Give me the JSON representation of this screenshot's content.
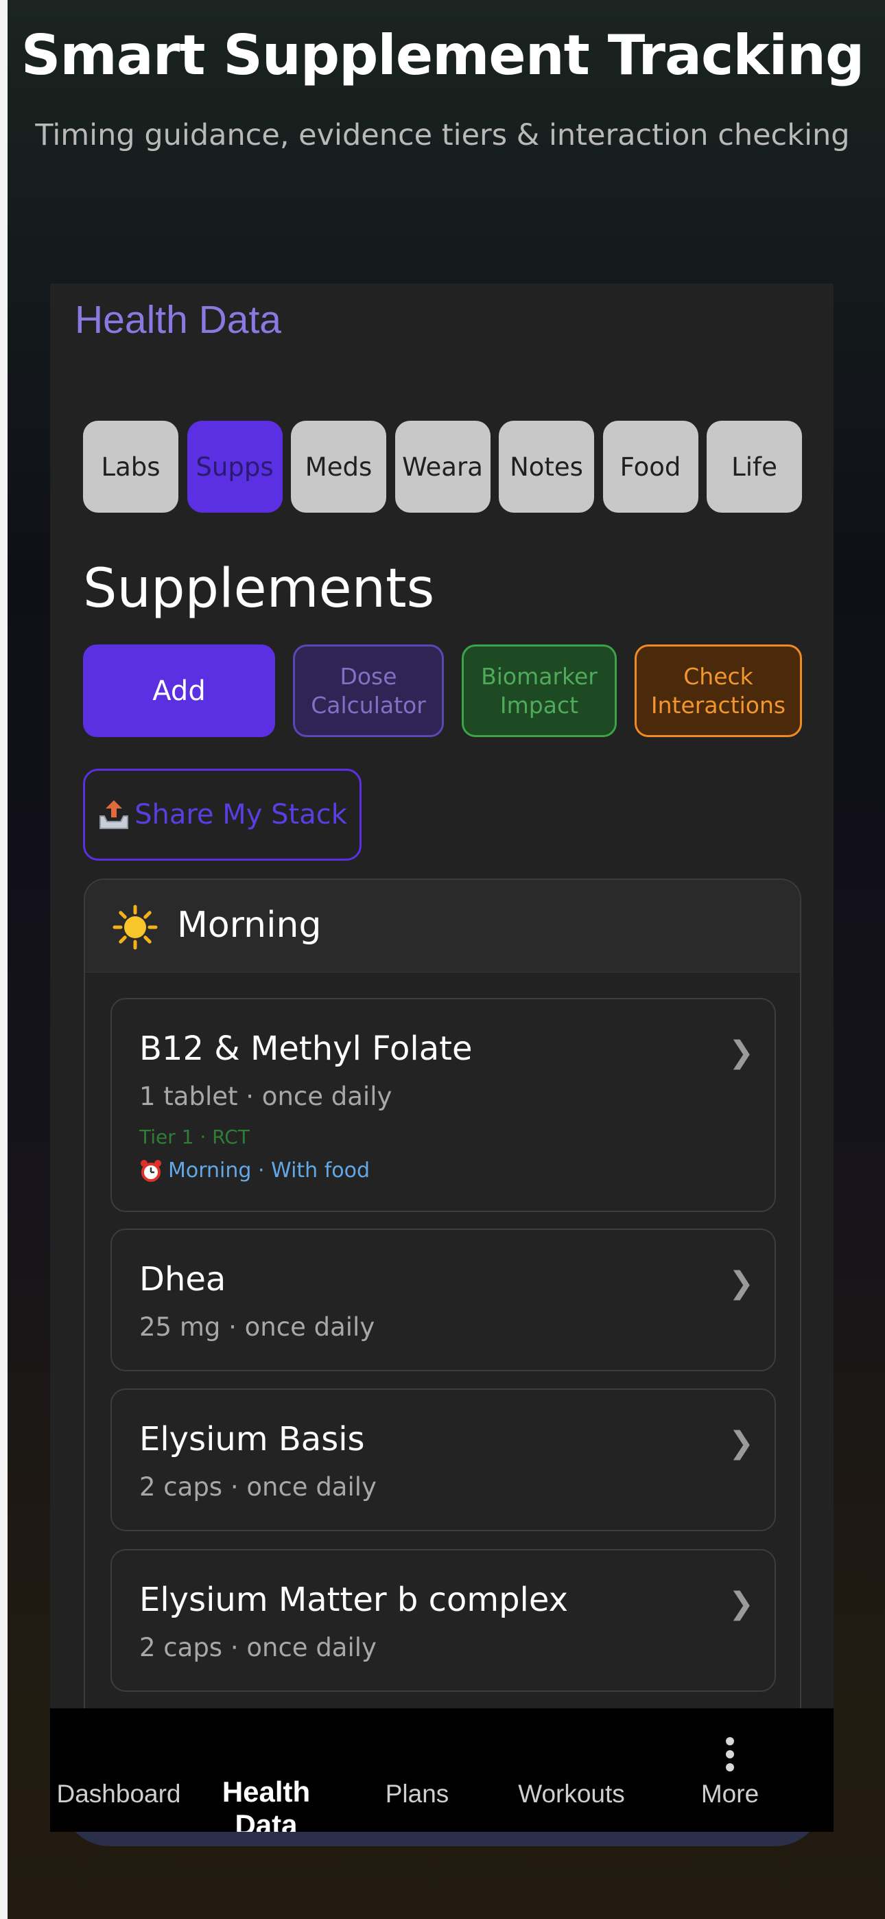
{
  "hero": {
    "title": "Smart Supplement Tracking",
    "subtitle": "Timing guidance, evidence tiers & interaction checking"
  },
  "app": {
    "title": "Health Data"
  },
  "tabs": [
    {
      "label": "Labs",
      "active": false
    },
    {
      "label": "Supps",
      "active": true
    },
    {
      "label": "Meds",
      "active": false
    },
    {
      "label": "Weara",
      "active": false
    },
    {
      "label": "Notes",
      "active": false
    },
    {
      "label": "Food",
      "active": false
    },
    {
      "label": "Life",
      "active": false
    }
  ],
  "section": {
    "title": "Supplements"
  },
  "actions": {
    "add": "Add",
    "dose_line1": "Dose",
    "dose_line2": "Calculator",
    "bio_line1": "Biomarker",
    "bio_line2": "Impact",
    "check_line1": "Check",
    "check_line2": "Interactions",
    "share": "Share My Stack"
  },
  "group": {
    "label": "Morning",
    "icon": "sun-icon"
  },
  "supplements": [
    {
      "name": "B12 & Methyl Folate",
      "dose": "1 tablet · once daily",
      "tier": "Tier 1 · RCT",
      "timing": "Morning · With food"
    },
    {
      "name": "Dhea",
      "dose": "25 mg · once daily"
    },
    {
      "name": "Elysium Basis",
      "dose": "2 caps · once daily"
    },
    {
      "name": "Elysium Matter b complex",
      "dose": "2 caps · once daily"
    }
  ],
  "nav": [
    {
      "label": "Dashboard",
      "active": false
    },
    {
      "label": "Health Data",
      "active": true
    },
    {
      "label": "Plans",
      "active": false
    },
    {
      "label": "Workouts",
      "active": false
    },
    {
      "label": "More",
      "active": false
    }
  ],
  "colors": {
    "accent": "#5b30e2",
    "title_purple": "#8b78e0",
    "tier_green": "#2f7d37",
    "timing_blue": "#63a8e6",
    "check_orange": "#f08a22"
  }
}
